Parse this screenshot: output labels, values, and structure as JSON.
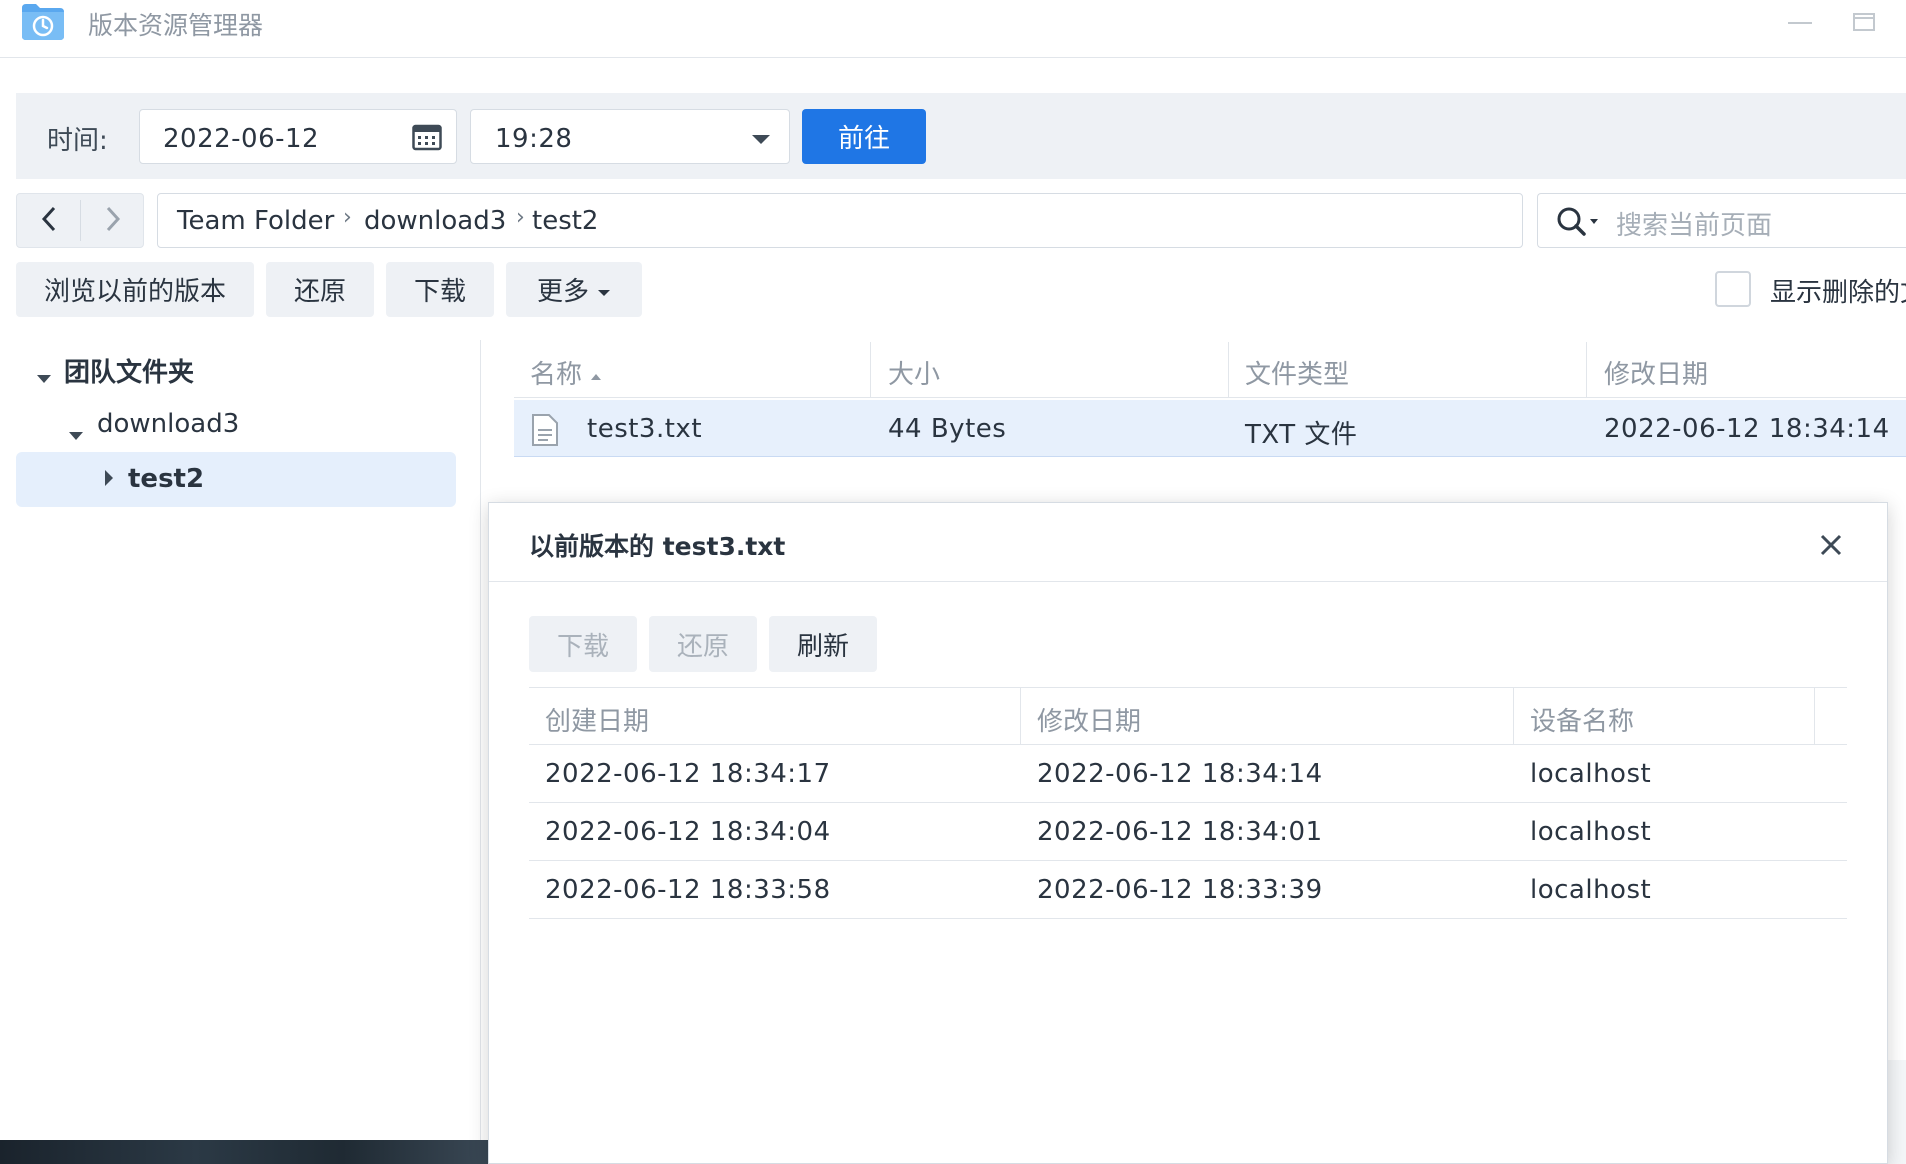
{
  "window": {
    "title": "版本资源管理器",
    "icon": "clock-folder-icon"
  },
  "timebar": {
    "label": "时间:",
    "date_value": "2022-06-12",
    "time_value": "19:28",
    "goto_label": "前往"
  },
  "breadcrumb": [
    "Team Folder",
    "download3",
    "test2"
  ],
  "search": {
    "placeholder": "搜索当前页面"
  },
  "toolbar": {
    "browse_label": "浏览以前的版本",
    "restore_label": "还原",
    "download_label": "下载",
    "more_label": "更多",
    "show_deleted_label": "显示删除的文"
  },
  "tree": {
    "root": "团队文件夹",
    "child": "download3",
    "selected": "test2"
  },
  "file_list": {
    "columns": [
      "名称",
      "大小",
      "文件类型",
      "修改日期"
    ],
    "rows": [
      {
        "name": "test3.txt",
        "size": "44 Bytes",
        "type": "TXT 文件",
        "modified": "2022-06-12 18:34:14"
      }
    ]
  },
  "dialog": {
    "title": "以前版本的 test3.txt",
    "download_label": "下载",
    "restore_label": "还原",
    "refresh_label": "刷新",
    "columns": [
      "创建日期",
      "修改日期",
      "设备名称"
    ],
    "rows": [
      {
        "created": "2022-06-12 18:34:17",
        "modified": "2022-06-12 18:34:14",
        "device": "localhost"
      },
      {
        "created": "2022-06-12 18:34:04",
        "modified": "2022-06-12 18:34:01",
        "device": "localhost"
      },
      {
        "created": "2022-06-12 18:33:58",
        "modified": "2022-06-12 18:33:39",
        "device": "localhost"
      }
    ]
  },
  "colors": {
    "accent": "#1f76e5",
    "selection": "#e5effc",
    "toolbar_bg": "#eef1f5"
  }
}
